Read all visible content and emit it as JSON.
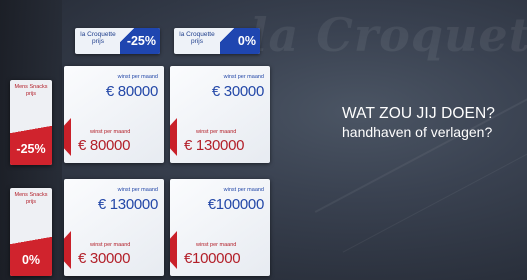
{
  "background": {
    "brand_text": "la Croquetr"
  },
  "top_tabs": [
    {
      "title": "la Croquette prijs",
      "pct": "-25%"
    },
    {
      "title": "la Croquette prijs",
      "pct": "0%"
    }
  ],
  "side_tabs": [
    {
      "title": "Mens Snacks prijs",
      "pct": "-25%"
    },
    {
      "title": "Mens Snacks prijs",
      "pct": "0%"
    }
  ],
  "cards": [
    {
      "blue_label": "winst per maand",
      "blue_value": "€ 80000",
      "red_label": "winst per maand",
      "red_value": "€ 80000"
    },
    {
      "blue_label": "winst per maand",
      "blue_value": "€ 30000",
      "red_label": "winst per maand",
      "red_value": "€ 130000"
    },
    {
      "blue_label": "winst per maand",
      "blue_value": "€ 130000",
      "red_label": "winst per maand",
      "red_value": "€ 30000"
    },
    {
      "blue_label": "winst per maand",
      "blue_value": "€100000",
      "red_label": "winst per maand",
      "red_value": "€100000"
    }
  ],
  "question": {
    "headline": "WAT ZOU JIJ DOEN?",
    "subline": "handhaven of verlagen?"
  },
  "colors": {
    "brand_blue": "#1f46b0",
    "brand_red": "#d0232d",
    "background": "#2f3644"
  }
}
